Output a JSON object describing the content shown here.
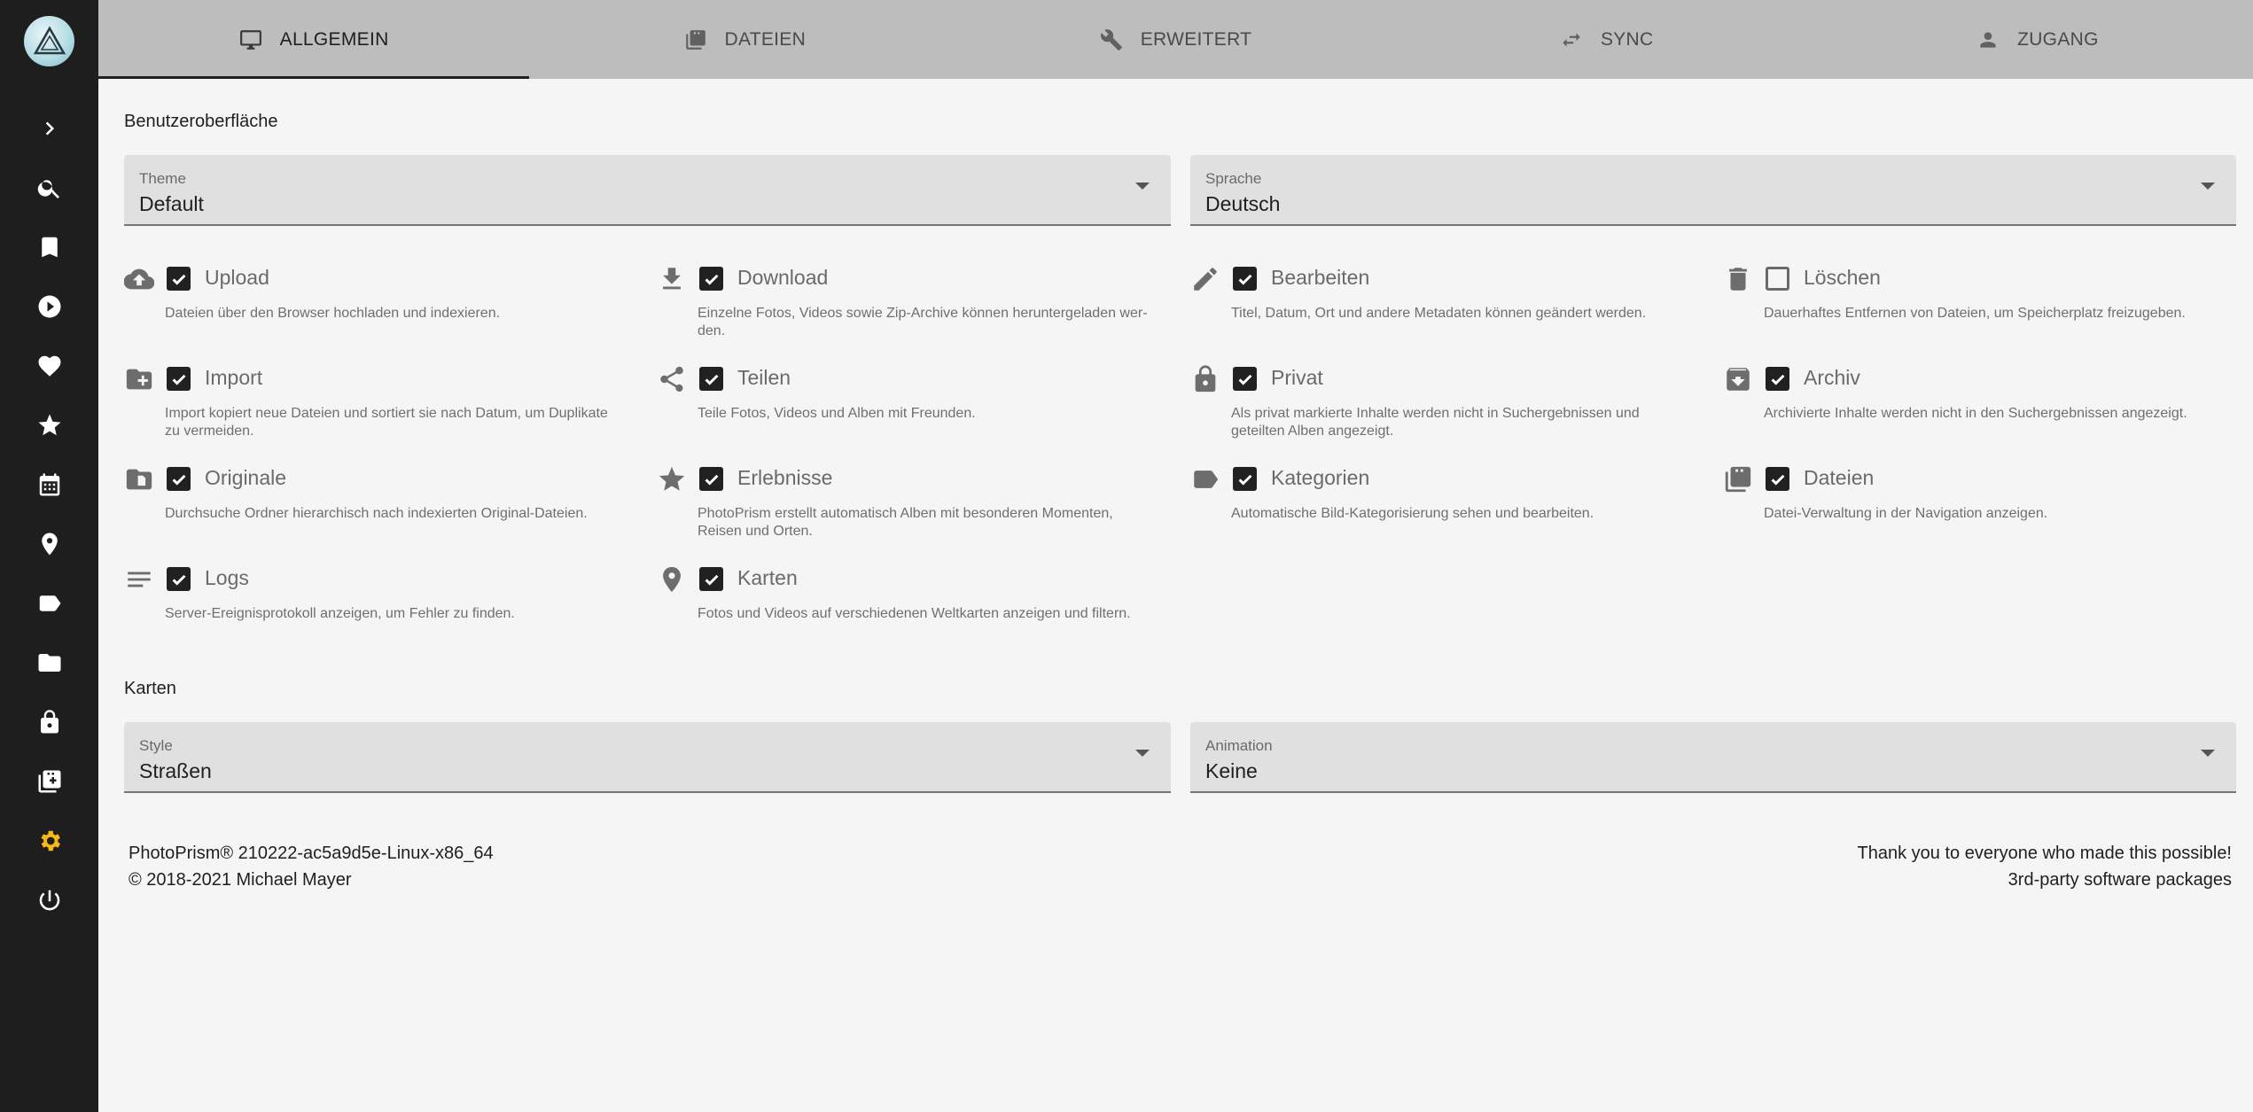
{
  "tabs": [
    {
      "label": "ALLGEMEIN",
      "icon": "monitor-icon",
      "active": true
    },
    {
      "label": "DATEIEN",
      "icon": "file-cabinet-icon",
      "active": false
    },
    {
      "label": "ERWEITERT",
      "icon": "wrench-icon",
      "active": false
    },
    {
      "label": "SYNC",
      "icon": "sync-arrows-icon",
      "active": false
    },
    {
      "label": "ZUGANG",
      "icon": "person-icon",
      "active": false
    }
  ],
  "sidebar": {
    "items": [
      "expand-chevron-icon",
      "search-icon",
      "bookmark-icon",
      "play-icon",
      "heart-icon",
      "star-icon",
      "calendar-icon",
      "map-pin-icon",
      "label-tag-icon",
      "folder-icon",
      "lock-icon",
      "file-cabinet-icon",
      "gear-icon",
      "power-icon"
    ],
    "active_color": "#f7b916"
  },
  "ui_section": {
    "title": "Benutzeroberfläche",
    "theme": {
      "label": "Theme",
      "value": "Default"
    },
    "language": {
      "label": "Sprache",
      "value": "Deutsch"
    }
  },
  "options": [
    {
      "icon": "cloud-upload-icon",
      "label": "Upload",
      "checked": true,
      "desc": "Dateien über den Browser hochladen und indexieren."
    },
    {
      "icon": "download-icon",
      "label": "Download",
      "checked": true,
      "desc": "Einzelne Fotos, Videos sowie Zip-Archive können heruntergeladen wer-den."
    },
    {
      "icon": "pencil-icon",
      "label": "Bearbeiten",
      "checked": true,
      "desc": "Titel, Datum, Ort und andere Metadaten können geändert werden."
    },
    {
      "icon": "trash-icon",
      "label": "Löschen",
      "checked": false,
      "desc": "Dauerhaftes Entfernen von Dateien, um Speicherplatz freizugeben."
    },
    {
      "icon": "folder-plus-icon",
      "label": "Import",
      "checked": true,
      "desc": "Import kopiert neue Dateien und sortiert sie nach Datum, um Duplikate zu vermeiden."
    },
    {
      "icon": "share-icon",
      "label": "Teilen",
      "checked": true,
      "desc": "Teile Fotos, Videos und Alben mit Freunden."
    },
    {
      "icon": "lock-icon",
      "label": "Privat",
      "checked": true,
      "desc": "Als privat markierte Inhalte werden nicht in Suchergebnissen und geteilten Alben angezeigt."
    },
    {
      "icon": "archive-icon",
      "label": "Archiv",
      "checked": true,
      "desc": "Archivierte Inhalte werden nicht in den Suchergebnissen angezeigt."
    },
    {
      "icon": "folder-file-icon",
      "label": "Originale",
      "checked": true,
      "desc": "Durchsuche Ordner hierarchisch nach indexierten Original-Dateien."
    },
    {
      "icon": "star-icon",
      "label": "Erlebnisse",
      "checked": true,
      "desc": "PhotoPrism erstellt automatisch Alben mit besonderen Momenten, Reisen und Orten."
    },
    {
      "icon": "label-tag-icon",
      "label": "Kategorien",
      "checked": true,
      "desc": "Automatische Bild-Kategorisierung sehen und bearbeiten."
    },
    {
      "icon": "file-cabinet-icon",
      "label": "Dateien",
      "checked": true,
      "desc": "Datei-Verwaltung in der Navigation anzeigen."
    },
    {
      "icon": "lines-icon",
      "label": "Logs",
      "checked": true,
      "desc": "Server-Ereignisprotokoll anzeigen, um Fehler zu finden."
    },
    {
      "icon": "map-pin-icon",
      "label": "Karten",
      "checked": true,
      "desc": "Fotos und Videos auf verschiedenen Weltkarten anzeigen und filtern."
    }
  ],
  "maps_section": {
    "title": "Karten",
    "style": {
      "label": "Style",
      "value": "Straßen"
    },
    "animation": {
      "label": "Animation",
      "value": "Keine"
    }
  },
  "footer": {
    "version": "PhotoPrism® 210222-ac5a9d5e-Linux-x86_64",
    "copyright": "© 2018-2021 Michael Mayer",
    "thanks": "Thank you to everyone who made this possible!",
    "packages": "3rd-party software packages"
  }
}
